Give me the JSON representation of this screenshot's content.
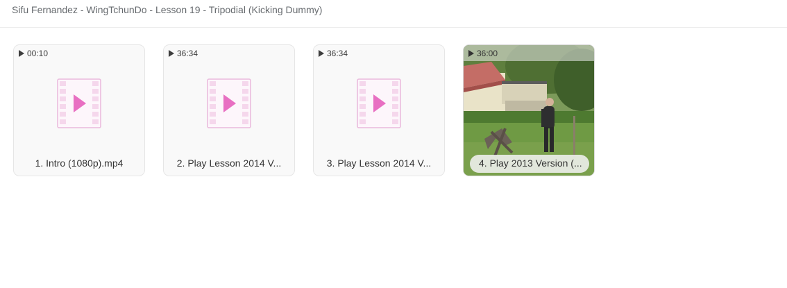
{
  "breadcrumb": "Sifu Fernandez - WingTchunDo - Lesson 19 - Tripodial (Kicking Dummy)",
  "files": [
    {
      "duration": "00:10",
      "name": "1. Intro (1080p).mp4",
      "thumbnail": "video-file-icon"
    },
    {
      "duration": "36:34",
      "name": "2. Play Lesson 2014 V...",
      "thumbnail": "video-file-icon"
    },
    {
      "duration": "36:34",
      "name": "3. Play Lesson 2014 V...",
      "thumbnail": "video-file-icon"
    },
    {
      "duration": "36:00",
      "name": "4. Play 2013 Version (...",
      "thumbnail": "video-thumbnail-image"
    }
  ],
  "colors": {
    "icon_accent": "#e86fc2",
    "icon_border": "#eab9dc",
    "icon_fill": "#fdf6fb"
  }
}
